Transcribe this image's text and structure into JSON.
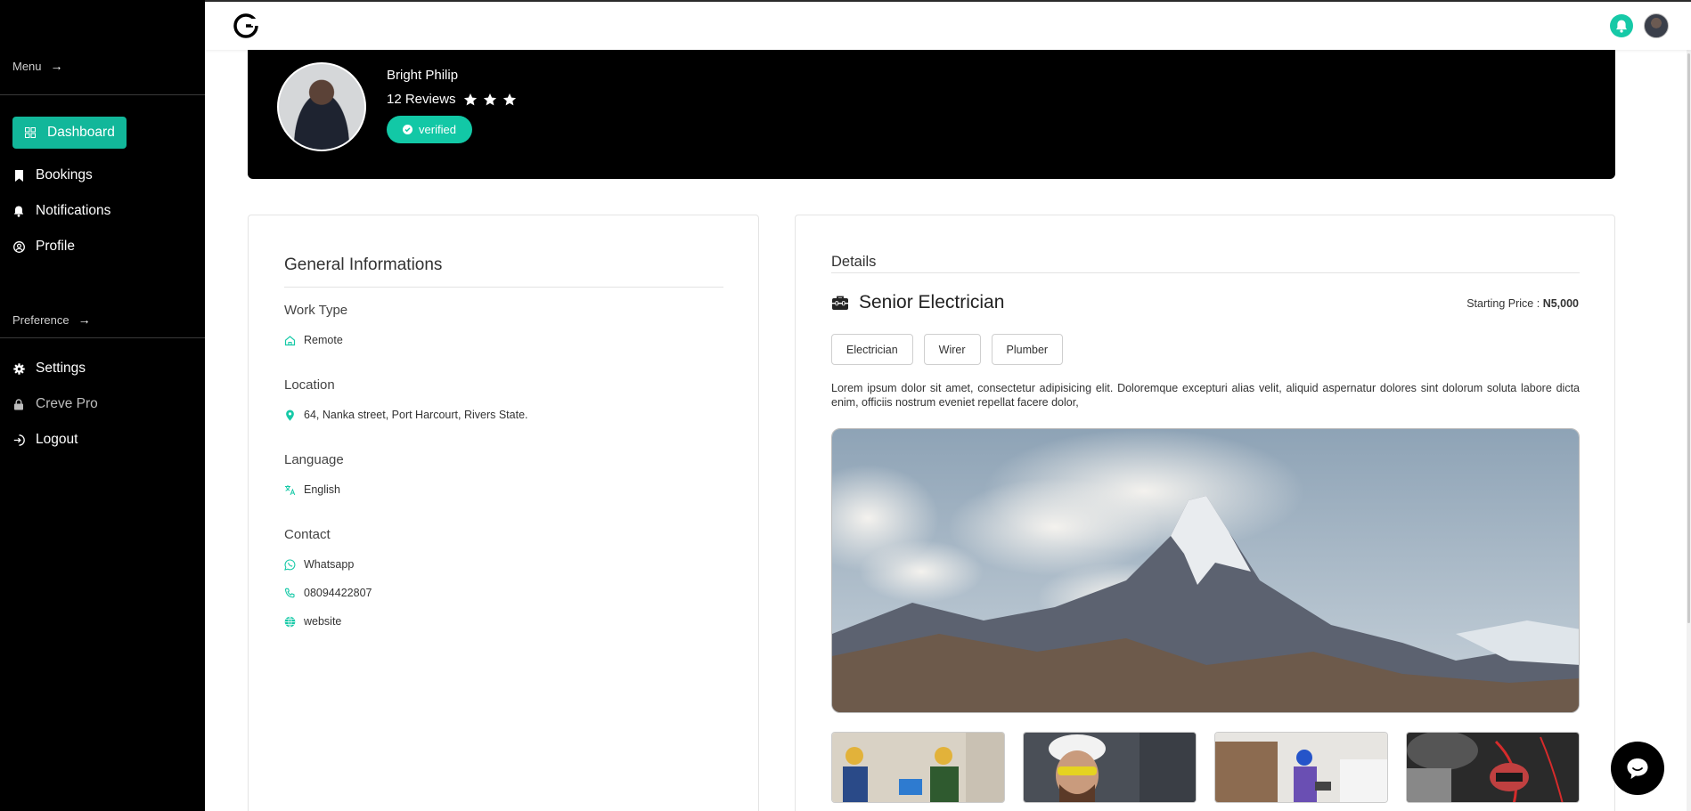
{
  "sidebar": {
    "menu_label": "Menu",
    "menu_arrow": "→",
    "items": [
      {
        "label": "Dashboard",
        "icon": "dashboard-icon"
      },
      {
        "label": "Bookings",
        "icon": "bookmark-icon"
      },
      {
        "label": "Notifications",
        "icon": "bell-icon"
      },
      {
        "label": "Profile",
        "icon": "user-circle-icon"
      }
    ],
    "preference_label": "Preference",
    "preference_arrow": "→",
    "pref_items": [
      {
        "label": "Settings",
        "icon": "gear-icon"
      },
      {
        "label": "Creve Pro",
        "icon": "lock-icon"
      },
      {
        "label": "Logout",
        "icon": "logout-icon"
      }
    ]
  },
  "topbar": {
    "logo_icon": "brand-logo-icon",
    "bell_icon": "bell-icon",
    "accent_color": "#16c9a7"
  },
  "profile": {
    "name": "Bright Philip",
    "reviews": "12 Reviews",
    "rating": 3,
    "verified_label": "verified"
  },
  "general_info": {
    "title": "General Informations",
    "work_type_label": "Work Type",
    "work_type_value": "Remote",
    "location_label": "Location",
    "location_value": "64, Nanka street, Port Harcourt, Rivers State.",
    "language_label": "Language",
    "language_value": "English",
    "contact_label": "Contact",
    "contact_whatsapp": "Whatsapp",
    "contact_phone": "08094422807",
    "contact_website": "website"
  },
  "details": {
    "title": "Details",
    "role": "Senior Electrician",
    "price_label": "Starting Price :",
    "price_value": "N5,000",
    "tags": [
      "Electrician",
      "Wirer",
      "Plumber"
    ],
    "description": "Lorem ipsum dolor sit amet, consectetur adipisicing elit. Doloremque excepturi alias velit, aliquid aspernatur dolores sint dolorum soluta labore dicta enim, officiis nostrum eveniet repellat facere dolor,"
  },
  "colors": {
    "sidebar_bg": "#000000",
    "accent": "#12b79a"
  }
}
